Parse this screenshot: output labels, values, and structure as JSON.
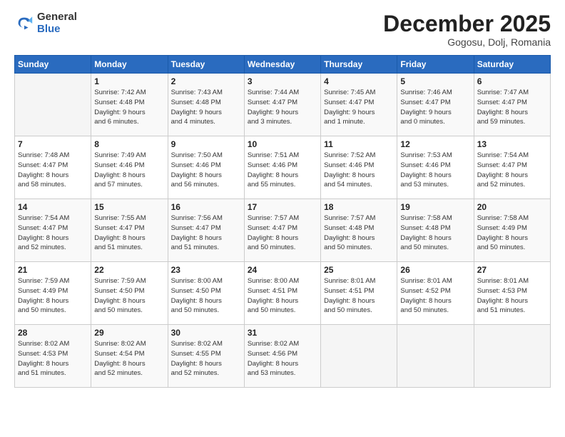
{
  "logo": {
    "general": "General",
    "blue": "Blue"
  },
  "title": "December 2025",
  "subtitle": "Gogosu, Dolj, Romania",
  "days_of_week": [
    "Sunday",
    "Monday",
    "Tuesday",
    "Wednesday",
    "Thursday",
    "Friday",
    "Saturday"
  ],
  "weeks": [
    [
      {
        "day": "",
        "info": ""
      },
      {
        "day": "1",
        "info": "Sunrise: 7:42 AM\nSunset: 4:48 PM\nDaylight: 9 hours\nand 6 minutes."
      },
      {
        "day": "2",
        "info": "Sunrise: 7:43 AM\nSunset: 4:48 PM\nDaylight: 9 hours\nand 4 minutes."
      },
      {
        "day": "3",
        "info": "Sunrise: 7:44 AM\nSunset: 4:47 PM\nDaylight: 9 hours\nand 3 minutes."
      },
      {
        "day": "4",
        "info": "Sunrise: 7:45 AM\nSunset: 4:47 PM\nDaylight: 9 hours\nand 1 minute."
      },
      {
        "day": "5",
        "info": "Sunrise: 7:46 AM\nSunset: 4:47 PM\nDaylight: 9 hours\nand 0 minutes."
      },
      {
        "day": "6",
        "info": "Sunrise: 7:47 AM\nSunset: 4:47 PM\nDaylight: 8 hours\nand 59 minutes."
      }
    ],
    [
      {
        "day": "7",
        "info": "Sunrise: 7:48 AM\nSunset: 4:47 PM\nDaylight: 8 hours\nand 58 minutes."
      },
      {
        "day": "8",
        "info": "Sunrise: 7:49 AM\nSunset: 4:46 PM\nDaylight: 8 hours\nand 57 minutes."
      },
      {
        "day": "9",
        "info": "Sunrise: 7:50 AM\nSunset: 4:46 PM\nDaylight: 8 hours\nand 56 minutes."
      },
      {
        "day": "10",
        "info": "Sunrise: 7:51 AM\nSunset: 4:46 PM\nDaylight: 8 hours\nand 55 minutes."
      },
      {
        "day": "11",
        "info": "Sunrise: 7:52 AM\nSunset: 4:46 PM\nDaylight: 8 hours\nand 54 minutes."
      },
      {
        "day": "12",
        "info": "Sunrise: 7:53 AM\nSunset: 4:46 PM\nDaylight: 8 hours\nand 53 minutes."
      },
      {
        "day": "13",
        "info": "Sunrise: 7:54 AM\nSunset: 4:47 PM\nDaylight: 8 hours\nand 52 minutes."
      }
    ],
    [
      {
        "day": "14",
        "info": "Sunrise: 7:54 AM\nSunset: 4:47 PM\nDaylight: 8 hours\nand 52 minutes."
      },
      {
        "day": "15",
        "info": "Sunrise: 7:55 AM\nSunset: 4:47 PM\nDaylight: 8 hours\nand 51 minutes."
      },
      {
        "day": "16",
        "info": "Sunrise: 7:56 AM\nSunset: 4:47 PM\nDaylight: 8 hours\nand 51 minutes."
      },
      {
        "day": "17",
        "info": "Sunrise: 7:57 AM\nSunset: 4:47 PM\nDaylight: 8 hours\nand 50 minutes."
      },
      {
        "day": "18",
        "info": "Sunrise: 7:57 AM\nSunset: 4:48 PM\nDaylight: 8 hours\nand 50 minutes."
      },
      {
        "day": "19",
        "info": "Sunrise: 7:58 AM\nSunset: 4:48 PM\nDaylight: 8 hours\nand 50 minutes."
      },
      {
        "day": "20",
        "info": "Sunrise: 7:58 AM\nSunset: 4:49 PM\nDaylight: 8 hours\nand 50 minutes."
      }
    ],
    [
      {
        "day": "21",
        "info": "Sunrise: 7:59 AM\nSunset: 4:49 PM\nDaylight: 8 hours\nand 50 minutes."
      },
      {
        "day": "22",
        "info": "Sunrise: 7:59 AM\nSunset: 4:50 PM\nDaylight: 8 hours\nand 50 minutes."
      },
      {
        "day": "23",
        "info": "Sunrise: 8:00 AM\nSunset: 4:50 PM\nDaylight: 8 hours\nand 50 minutes."
      },
      {
        "day": "24",
        "info": "Sunrise: 8:00 AM\nSunset: 4:51 PM\nDaylight: 8 hours\nand 50 minutes."
      },
      {
        "day": "25",
        "info": "Sunrise: 8:01 AM\nSunset: 4:51 PM\nDaylight: 8 hours\nand 50 minutes."
      },
      {
        "day": "26",
        "info": "Sunrise: 8:01 AM\nSunset: 4:52 PM\nDaylight: 8 hours\nand 50 minutes."
      },
      {
        "day": "27",
        "info": "Sunrise: 8:01 AM\nSunset: 4:53 PM\nDaylight: 8 hours\nand 51 minutes."
      }
    ],
    [
      {
        "day": "28",
        "info": "Sunrise: 8:02 AM\nSunset: 4:53 PM\nDaylight: 8 hours\nand 51 minutes."
      },
      {
        "day": "29",
        "info": "Sunrise: 8:02 AM\nSunset: 4:54 PM\nDaylight: 8 hours\nand 52 minutes."
      },
      {
        "day": "30",
        "info": "Sunrise: 8:02 AM\nSunset: 4:55 PM\nDaylight: 8 hours\nand 52 minutes."
      },
      {
        "day": "31",
        "info": "Sunrise: 8:02 AM\nSunset: 4:56 PM\nDaylight: 8 hours\nand 53 minutes."
      },
      {
        "day": "",
        "info": ""
      },
      {
        "day": "",
        "info": ""
      },
      {
        "day": "",
        "info": ""
      }
    ]
  ]
}
